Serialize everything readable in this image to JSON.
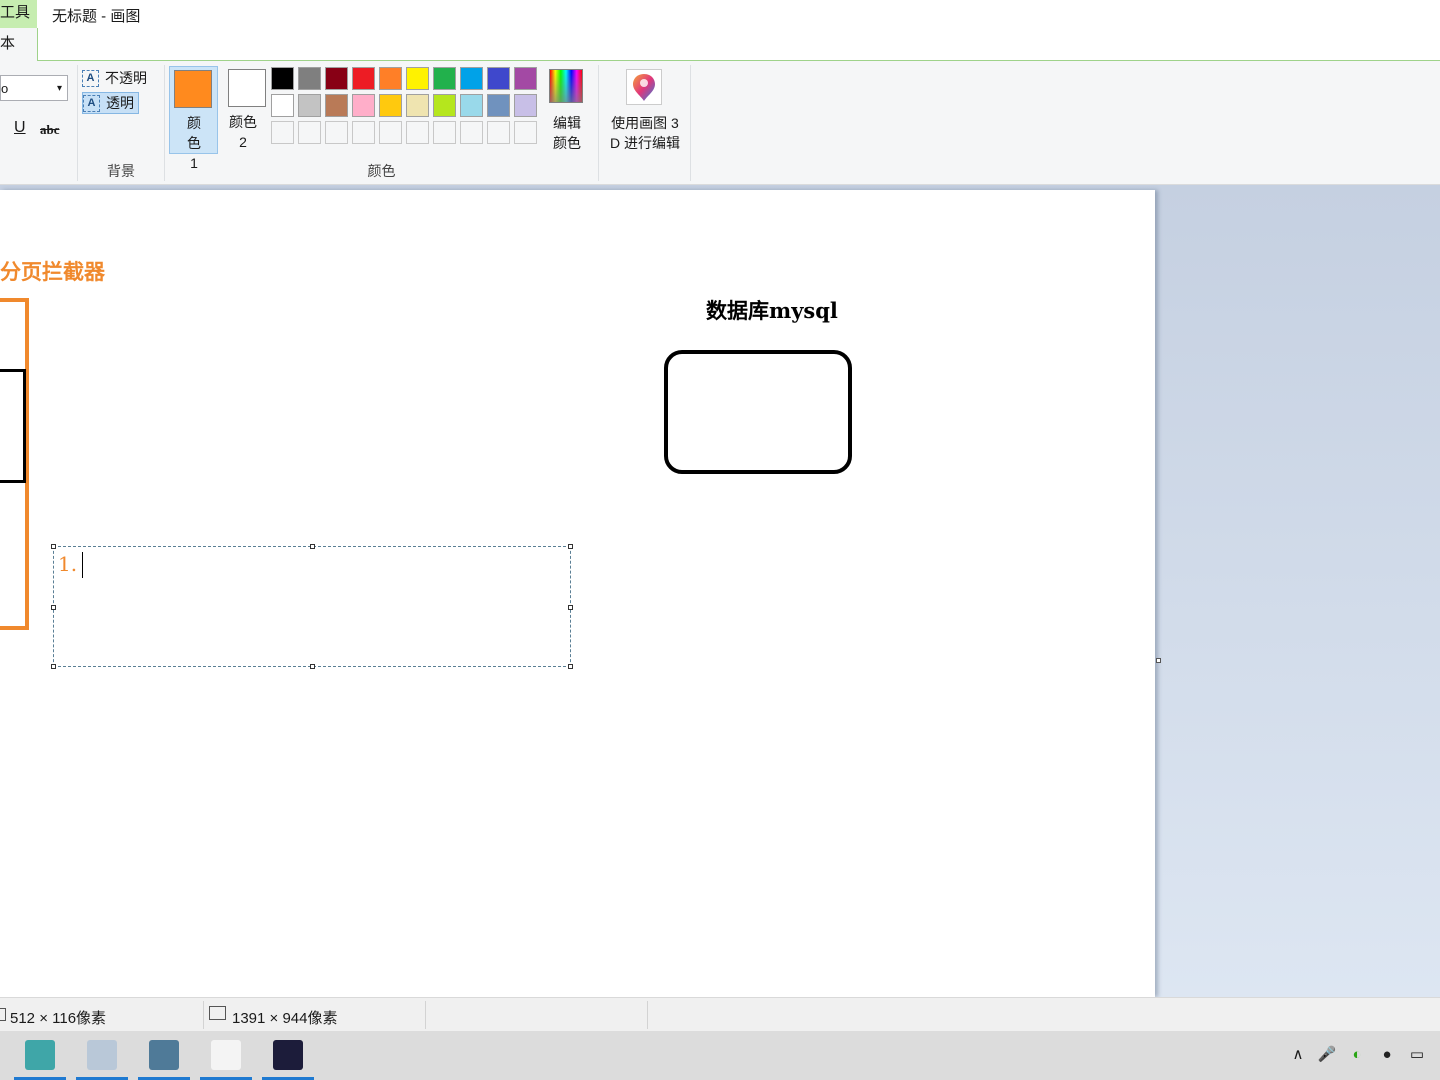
{
  "window": {
    "title": "无标题 - 画图",
    "context_tab": "工具",
    "active_tab": "本"
  },
  "ribbon": {
    "font": {
      "size_value": "o",
      "dropdown_arrow": "▾",
      "underline": "U",
      "strikethrough": "abc"
    },
    "background": {
      "label": "背景",
      "opaque": "不透明",
      "transparent": "透明",
      "icon_glyph": "A"
    },
    "colors": {
      "label": "颜色",
      "color1_label": "颜色 1",
      "color2_label": "颜色 2",
      "color1_value": "#ff8a1e",
      "color2_value": "#ffffff",
      "edit_colors_label": "编辑颜色",
      "palette": [
        [
          "#000000",
          "#7f7f7f",
          "#880015",
          "#ed1c24",
          "#ff7f27",
          "#fff200",
          "#22b14c",
          "#00a2e8",
          "#3f48cc",
          "#a349a4"
        ],
        [
          "#ffffff",
          "#c3c3c3",
          "#b97a57",
          "#ffaec9",
          "#ffc90e",
          "#efe4b0",
          "#b5e61d",
          "#99d9ea",
          "#7092be",
          "#c8bfe7"
        ],
        [
          "#f5f6f7",
          "#f5f6f7",
          "#f5f6f7",
          "#f5f6f7",
          "#f5f6f7",
          "#f5f6f7",
          "#f5f6f7",
          "#f5f6f7",
          "#f5f6f7",
          "#f5f6f7"
        ]
      ]
    },
    "paint3d": {
      "label_line1": "使用画图 3",
      "label_line2": "D 进行编辑"
    }
  },
  "canvas": {
    "interceptor_title": "分页拦截器",
    "db_title": "数据库mysql",
    "textbox_content": "1.",
    "accent_color": "#f0892d"
  },
  "status": {
    "selection_size": "512 × 116像素",
    "image_size": "1391 × 944像素"
  },
  "taskbar": {
    "apps": [
      {
        "name": "intellij-idea-alt-icon",
        "color": "#3fa6a8",
        "active": true
      },
      {
        "name": "paint-icon",
        "color": "#b9c8d8",
        "active": true
      },
      {
        "name": "image-viewer-icon",
        "color": "#4f7a98",
        "active": true
      },
      {
        "name": "typora-icon",
        "color": "#f4f4f4",
        "active": true
      },
      {
        "name": "intellij-idea-icon",
        "color": "#1c1c3a",
        "active": true
      }
    ],
    "tray": {
      "chevron": "∧",
      "mic": "🎤",
      "wechat": "◐",
      "qq": "●",
      "battery": "▭"
    }
  }
}
